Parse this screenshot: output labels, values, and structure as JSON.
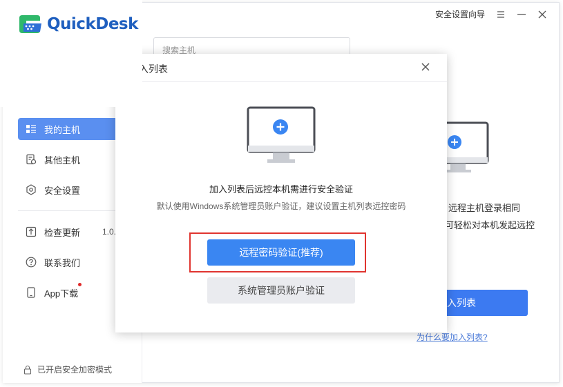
{
  "app": {
    "name": "QuickDesk"
  },
  "topbar": {
    "wizard_label": "安全设置向导",
    "menu_icon": "menu-icon",
    "minimize_icon": "minimize-icon",
    "close_icon": "close-icon"
  },
  "search": {
    "placeholder": "搜索主机"
  },
  "sidebar": {
    "items": [
      {
        "label": "我的主机",
        "icon": "host-list-icon",
        "active": true
      },
      {
        "label": "其他主机",
        "icon": "other-host-icon",
        "active": false
      },
      {
        "label": "安全设置",
        "icon": "shield-icon",
        "active": false
      },
      {
        "label": "检查更新",
        "icon": "update-icon",
        "active": false
      },
      {
        "label": "联系我们",
        "icon": "help-icon",
        "active": false
      },
      {
        "label": "App下载",
        "icon": "phone-icon",
        "active": false
      }
    ],
    "version": "1.0.",
    "footer": "已开启安全加密模式"
  },
  "background": {
    "text_line1": "列表，远程主机登录相同",
    "text_line2": "可轻松对本机发起远控",
    "button_label": "入列表",
    "link_label": "为什么要加入列表?"
  },
  "dialog": {
    "title": "入列表",
    "heading": "加入列表后远控本机需进行安全验证",
    "subtext": "默认使用Windows系统管理员账户验证，建议设置主机列表远控密码",
    "primary_button": "远程密码验证(推荐)",
    "secondary_button": "系统管理员账户验证"
  },
  "colors": {
    "accent": "#3a86f2",
    "nav_active": "#5a8ff0",
    "highlight": "#e0342f",
    "brand": "#1f5fbf"
  }
}
